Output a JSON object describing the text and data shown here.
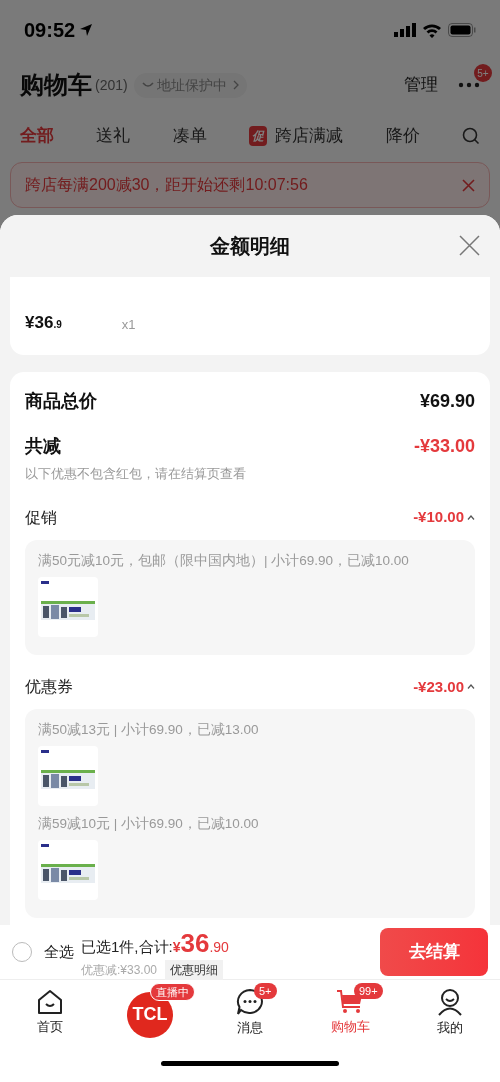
{
  "status_bar": {
    "time": "09:52"
  },
  "header": {
    "title": "购物车",
    "count": "(201)",
    "address": "地址保护中",
    "manage": "管理",
    "more_badge": "5+"
  },
  "tabs": [
    {
      "label": "全部",
      "selected": true
    },
    {
      "label": "送礼",
      "selected": false
    },
    {
      "label": "凑单",
      "selected": false
    },
    {
      "label": "跨店满减",
      "selected": false,
      "badge": "促"
    },
    {
      "label": "降价",
      "selected": false
    }
  ],
  "banner": {
    "text": "跨店每满200减30，距开始还剩10:07:56"
  },
  "sheet": {
    "title": "金额明细",
    "product": {
      "price": "¥36",
      "price_decimal": ".9",
      "quantity": "x1"
    },
    "summary": {
      "total_label": "商品总价",
      "total": "¥69.90",
      "reduce_label": "共减",
      "reduce": "-¥33.00",
      "note": "以下优惠不包含红包，请在结算页查看"
    },
    "sections": [
      {
        "title": "促销",
        "amount": "-¥10.00",
        "expanded": true,
        "entries": [
          {
            "text": "满50元减10元，包邮（限中国内地）| 小计69.90，已减10.00",
            "kind": "picture"
          }
        ]
      },
      {
        "title": "优惠券",
        "amount": "-¥23.00",
        "expanded": true,
        "entries": [
          {
            "text": "满50减13元 | 小计69.90，已减13.00",
            "kind": "picture"
          },
          {
            "text": "满59减10元 | 小计69.90，已减10.00",
            "kind": "picture"
          }
        ]
      }
    ]
  },
  "footer": {
    "select_all": {
      "label": "全选",
      "checked": false
    },
    "summary": "已选1件,合计:",
    "currency": "¥",
    "amount": "36",
    "amount_decimal": ".90",
    "discount": "优惠减:¥33.00",
    "detail_button": "优惠明细",
    "checkout": "去结算"
  },
  "nav": [
    {
      "kind": "home",
      "label": "首页",
      "selected": false
    },
    {
      "kind": "live",
      "logo": "TCL",
      "badge": "直播中",
      "selected": false
    },
    {
      "kind": "message",
      "label": "消息",
      "badge": "5+",
      "selected": false
    },
    {
      "kind": "cart",
      "label": "购物车",
      "badge": "99+",
      "selected": true
    },
    {
      "kind": "profile",
      "label": "我的",
      "selected": false
    }
  ]
}
